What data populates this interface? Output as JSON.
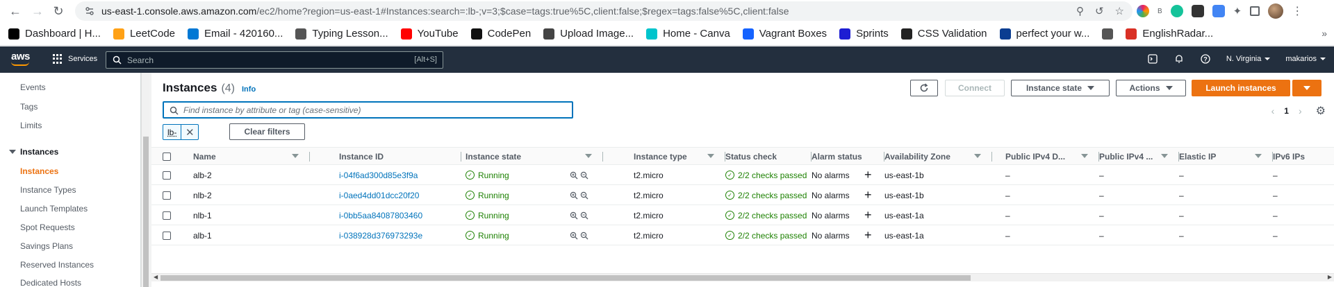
{
  "browser": {
    "url_host": "us-east-1.console.aws.amazon.com",
    "url_rest": "/ec2/home?region=us-east-1#Instances:search=:lb-;v=3;$case=tags:true%5C,client:false;$regex=tags:false%5C,client:false",
    "bookmarks": [
      {
        "label": "Dashboard | H...",
        "color": "#000000"
      },
      {
        "label": "LeetCode",
        "color": "#ffa116"
      },
      {
        "label": "Email - 420160...",
        "color": "#0078d4"
      },
      {
        "label": "Typing Lesson...",
        "color": "#555555"
      },
      {
        "label": "YouTube",
        "color": "#ff0000"
      },
      {
        "label": "CodePen",
        "color": "#111111"
      },
      {
        "label": "Upload Image...",
        "color": "#444444"
      },
      {
        "label": "Home - Canva",
        "color": "#00c4cc"
      },
      {
        "label": "Vagrant Boxes",
        "color": "#1563ff"
      },
      {
        "label": "Sprints",
        "color": "#1d1dd3"
      },
      {
        "label": "CSS Validation",
        "color": "#222222"
      },
      {
        "label": "perfect your w...",
        "color": "#0b3d91"
      },
      {
        "label": "",
        "color": "#555555"
      },
      {
        "label": "EnglishRadar...",
        "color": "#d93025"
      }
    ]
  },
  "aws": {
    "services_label": "Services",
    "search_placeholder": "Search",
    "search_shortcut": "[Alt+S]",
    "region": "N. Virginia",
    "user": "makarios"
  },
  "sidebar": {
    "items": [
      {
        "label": "Events"
      },
      {
        "label": "Tags"
      },
      {
        "label": "Limits"
      }
    ],
    "section": "Instances",
    "sub_items": [
      {
        "label": "Instances",
        "active": true
      },
      {
        "label": "Instance Types"
      },
      {
        "label": "Launch Templates"
      },
      {
        "label": "Spot Requests"
      },
      {
        "label": "Savings Plans"
      },
      {
        "label": "Reserved Instances"
      },
      {
        "label": "Dedicated Hosts"
      }
    ]
  },
  "main": {
    "title": "Instances",
    "count": "(4)",
    "info": "Info",
    "buttons": {
      "connect": "Connect",
      "instance_state": "Instance state",
      "actions": "Actions",
      "launch": "Launch instances"
    },
    "filter_placeholder": "Find instance by attribute or tag (case-sensitive)",
    "token": "lb-",
    "clear_filters": "Clear filters",
    "page": "1"
  },
  "table": {
    "columns": [
      "Name",
      "Instance ID",
      "Instance state",
      "Instance type",
      "Status check",
      "Alarm status",
      "Availability Zone",
      "Public IPv4 D...",
      "Public IPv4 ...",
      "Elastic IP",
      "IPv6 IPs"
    ],
    "rows": [
      {
        "name": "alb-2",
        "id": "i-04f6ad300d85e3f9a",
        "state": "Running",
        "type": "t2.micro",
        "status": "2/2 checks passed",
        "alarm": "No alarms",
        "az": "us-east-1b",
        "dns": "–",
        "ip": "–",
        "eip": "–",
        "ipv6": "–"
      },
      {
        "name": "nlb-2",
        "id": "i-0aed4dd01dcc20f20",
        "state": "Running",
        "type": "t2.micro",
        "status": "2/2 checks passed",
        "alarm": "No alarms",
        "az": "us-east-1b",
        "dns": "–",
        "ip": "–",
        "eip": "–",
        "ipv6": "–"
      },
      {
        "name": "nlb-1",
        "id": "i-0bb5aa84087803460",
        "state": "Running",
        "type": "t2.micro",
        "status": "2/2 checks passed",
        "alarm": "No alarms",
        "az": "us-east-1a",
        "dns": "–",
        "ip": "–",
        "eip": "–",
        "ipv6": "–"
      },
      {
        "name": "alb-1",
        "id": "i-038928d376973293e",
        "state": "Running",
        "type": "t2.micro",
        "status": "2/2 checks passed",
        "alarm": "No alarms",
        "az": "us-east-1a",
        "dns": "–",
        "ip": "–",
        "eip": "–",
        "ipv6": "–"
      }
    ]
  },
  "colors": {
    "aws_nav": "#232f3e",
    "accent": "#ec7211",
    "link": "#0073bb",
    "success": "#1d8102"
  }
}
